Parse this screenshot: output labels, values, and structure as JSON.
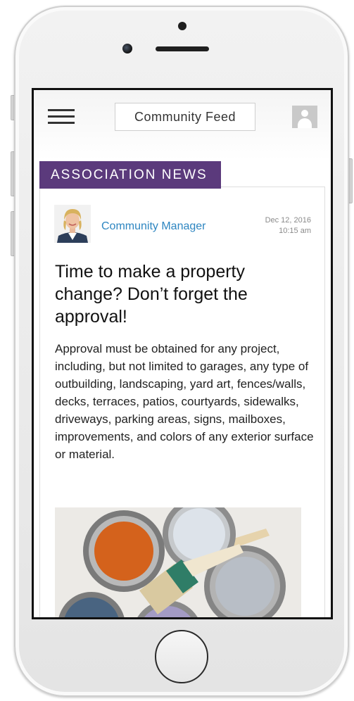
{
  "header": {
    "title": "Community Feed"
  },
  "section": {
    "label": "ASSOCIATION NEWS"
  },
  "post": {
    "author": "Community Manager",
    "date": "Dec 12, 2016",
    "time": "10:15 am",
    "title": "Time to make a property change? Don’t forget the approval!",
    "body": "Approval must be obtained for any project, including, but not limited to garages, any type of outbuilding, landscaping, yard art, fences/walls, decks, terraces, patios, courtyards, sidewalks, driveways, parking areas, signs, mailboxes, improvements, and colors of any exterior surface or material."
  },
  "icons": {
    "menu": "menu-icon",
    "user": "user-icon"
  },
  "colors": {
    "accent_purple": "#5b3a7c",
    "link_blue": "#2e86c1"
  }
}
